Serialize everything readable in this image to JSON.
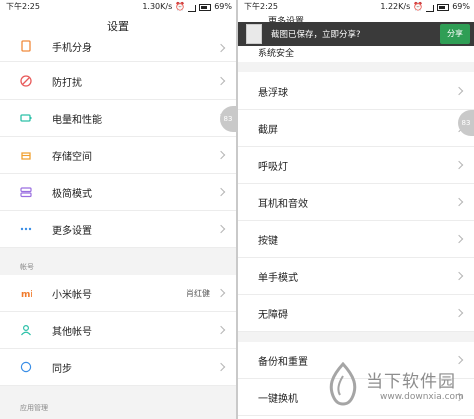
{
  "left_screen": {
    "status": {
      "time": "下午2:25",
      "speed": "1.30K/s",
      "battery": "69%"
    },
    "title": "设置",
    "rows": [
      {
        "label": "手机分身",
        "icon": "clone-icon"
      },
      {
        "label": "防打扰",
        "icon": "do-not-disturb-icon"
      },
      {
        "label": "电量和性能",
        "icon": "battery-icon"
      },
      {
        "label": "存储空间",
        "icon": "storage-icon"
      },
      {
        "label": "极简模式",
        "icon": "simple-mode-icon"
      },
      {
        "label": "更多设置",
        "icon": "more-icon"
      }
    ],
    "section_account": "帐号",
    "account_rows": [
      {
        "label": "小米帐号",
        "value": "肖红健",
        "icon": "mi-logo-icon"
      },
      {
        "label": "其他帐号",
        "icon": "account-icon"
      },
      {
        "label": "同步",
        "icon": "sync-icon"
      }
    ],
    "section_apps": "应用管理",
    "edge_badge": "83"
  },
  "right_screen": {
    "status": {
      "time": "下午2:25",
      "speed": "1.22K/s",
      "battery": "69%"
    },
    "title_partial": "更多设置",
    "first_row_partial": "系统安全",
    "toast": {
      "message": "截图已保存，立即分享?",
      "share_label": "分享"
    },
    "rows": [
      {
        "label": "悬浮球"
      },
      {
        "label": "截屏"
      },
      {
        "label": "呼吸灯"
      },
      {
        "label": "耳机和音效"
      },
      {
        "label": "按键"
      },
      {
        "label": "单手模式"
      },
      {
        "label": "无障碍"
      },
      {
        "label": "备份和重置"
      },
      {
        "label": "一键换机"
      }
    ],
    "edge_badge": "83"
  },
  "watermark": {
    "main": "当下软件园",
    "sub": "www.downxia.com"
  },
  "colors": {
    "accent_green": "#2f9e55",
    "divider": "#ececec",
    "section_bg": "#f3f3f3"
  }
}
